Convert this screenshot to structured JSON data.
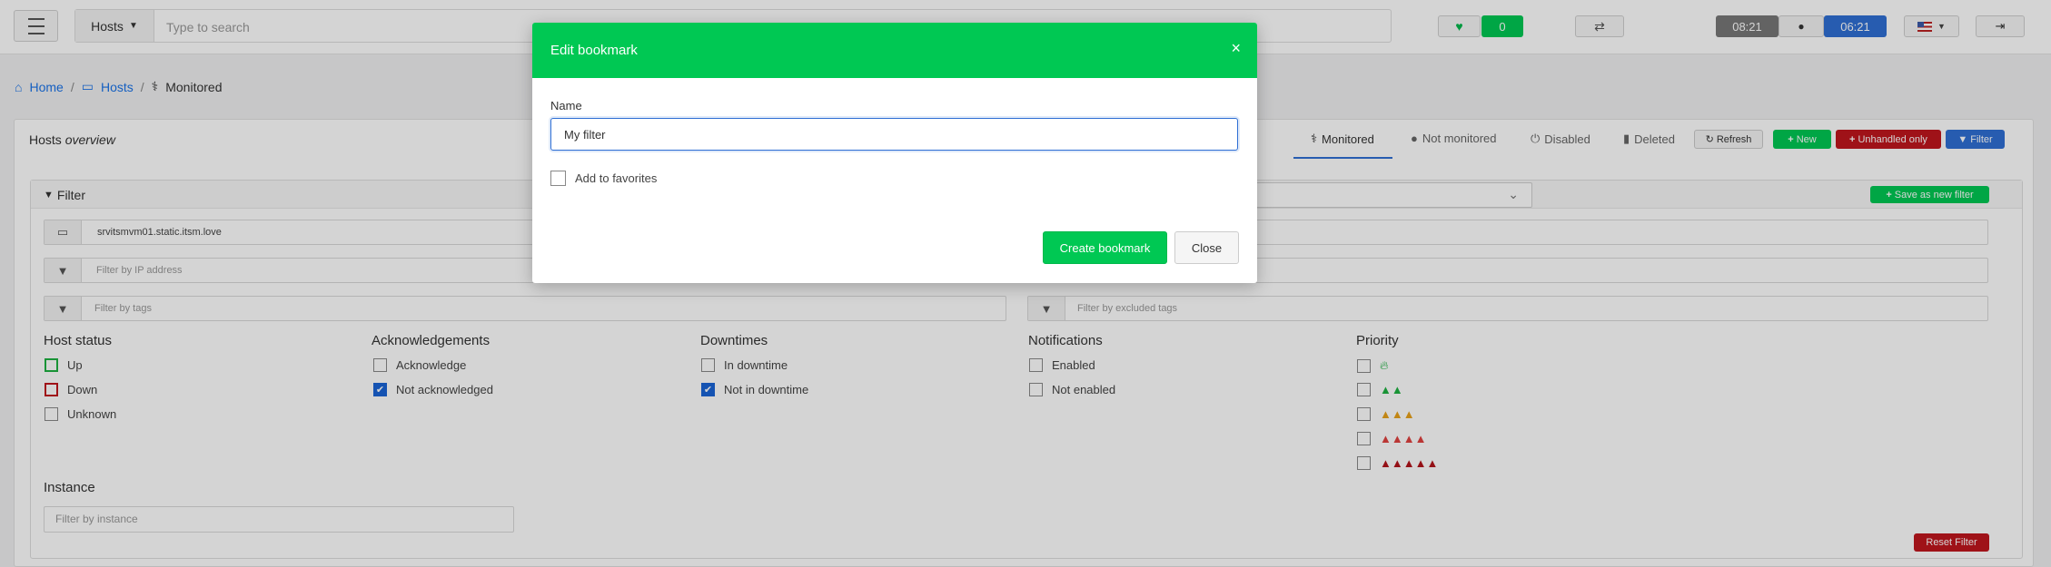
{
  "topbar": {
    "hosts_select": "Hosts",
    "search_placeholder": "Type to search",
    "heartbeat_count": "0",
    "time_server": "08:21",
    "time_local": "06:21"
  },
  "breadcrumb": {
    "home": "Home",
    "hosts": "Hosts",
    "current": "Monitored"
  },
  "card": {
    "title_main": "Hosts",
    "title_italic": "overview",
    "tabs": [
      "Monitored",
      "Not monitored",
      "Disabled",
      "Deleted"
    ],
    "buttons": {
      "refresh": "Refresh",
      "new": "New",
      "unhandled": "Unhandled only",
      "filter": "Filter"
    }
  },
  "filter": {
    "title": "Filter",
    "save_new": "Save as new filter",
    "hostname_value": "srvitsmvm01.static.itsm.love",
    "ip_placeholder": "Filter by IP address",
    "tags_placeholder": "Filter by tags",
    "excluded_tags_placeholder": "Filter by excluded tags",
    "groups": {
      "host_status": {
        "title": "Host status",
        "items": [
          "Up",
          "Down",
          "Unknown"
        ]
      },
      "acknowledgements": {
        "title": "Acknowledgements",
        "items": [
          "Acknowledge",
          "Not acknowledged"
        ]
      },
      "downtimes": {
        "title": "Downtimes",
        "items": [
          "In downtime",
          "Not in downtime"
        ]
      },
      "notifications": {
        "title": "Notifications",
        "items": [
          "Enabled",
          "Not enabled"
        ]
      },
      "priority": {
        "title": "Priority"
      }
    },
    "instance_title": "Instance",
    "instance_placeholder": "Filter by instance",
    "reset": "Reset Filter"
  },
  "modal": {
    "title": "Edit bookmark",
    "name_label": "Name",
    "name_value": "My filter",
    "favorites_label": "Add to favorites",
    "create_button": "Create bookmark",
    "close_button": "Close"
  },
  "colors": {
    "green": "#00c853",
    "red": "#c0161d",
    "blue": "#2f6fd4",
    "orange": "#e8a21a"
  }
}
